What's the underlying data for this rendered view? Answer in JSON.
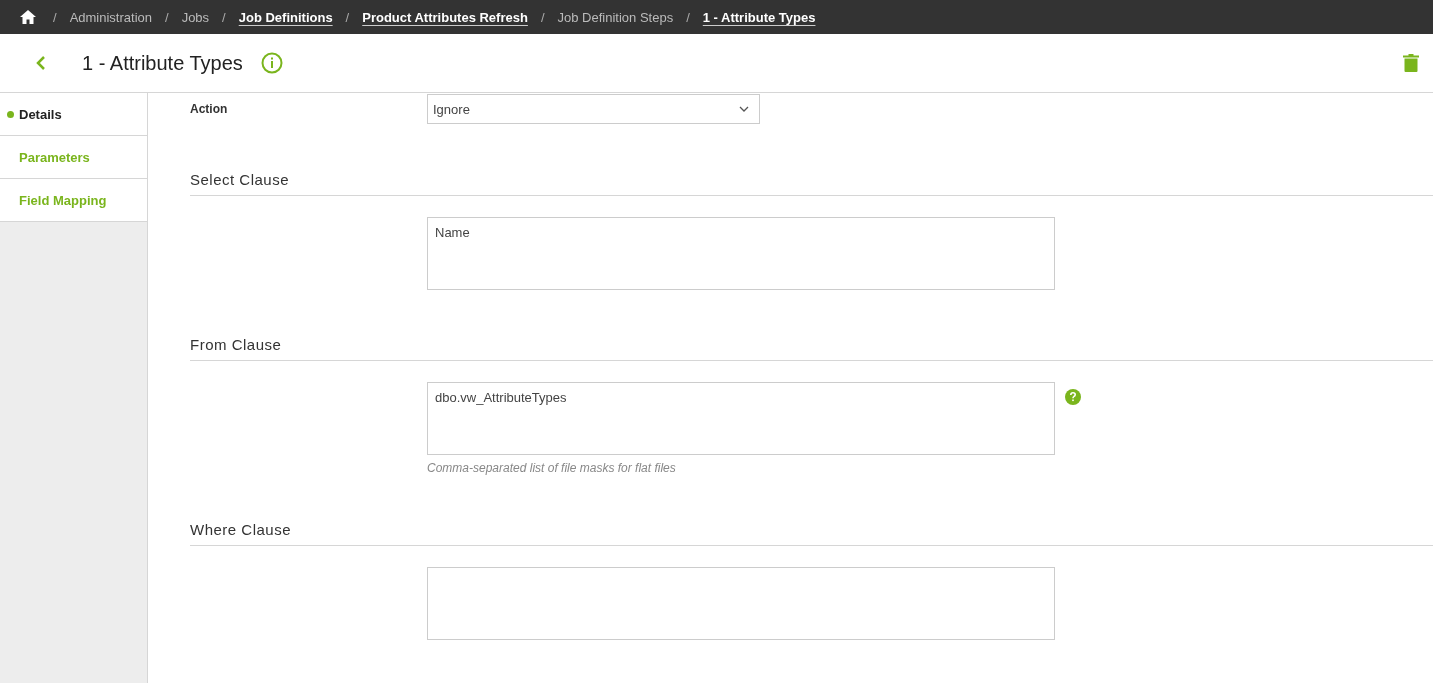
{
  "breadcrumbs": [
    {
      "label": "Administration",
      "kind": "plain"
    },
    {
      "label": "Jobs",
      "kind": "plain"
    },
    {
      "label": "Job Definitions",
      "kind": "link"
    },
    {
      "label": "Product Attributes Refresh",
      "kind": "link"
    },
    {
      "label": "Job Definition Steps",
      "kind": "plain"
    },
    {
      "label": "1 - Attribute Types",
      "kind": "link"
    }
  ],
  "separator": "/",
  "page_title": "1 - Attribute Types",
  "sidebar": {
    "items": [
      {
        "label": "Details",
        "selected": true
      },
      {
        "label": "Parameters",
        "selected": false
      },
      {
        "label": "Field Mapping",
        "selected": false
      }
    ]
  },
  "action": {
    "label": "Action",
    "value": "Ignore"
  },
  "sections": [
    {
      "title": "Select Clause",
      "value": "Name",
      "help": false
    },
    {
      "title": "From Clause",
      "value": "dbo.vw_AttributeTypes",
      "help": true,
      "hint": "Comma-separated list of file masks for flat files"
    },
    {
      "title": "Where Clause",
      "help": false
    }
  ]
}
